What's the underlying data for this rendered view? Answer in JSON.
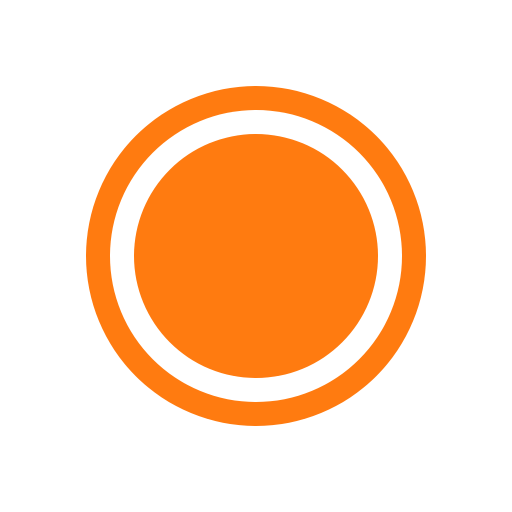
{
  "icon": {
    "name": "record-icon",
    "colors": {
      "background": "#ffffff",
      "accent": "#ff7b10",
      "ring_gap": "#ffffff"
    }
  }
}
